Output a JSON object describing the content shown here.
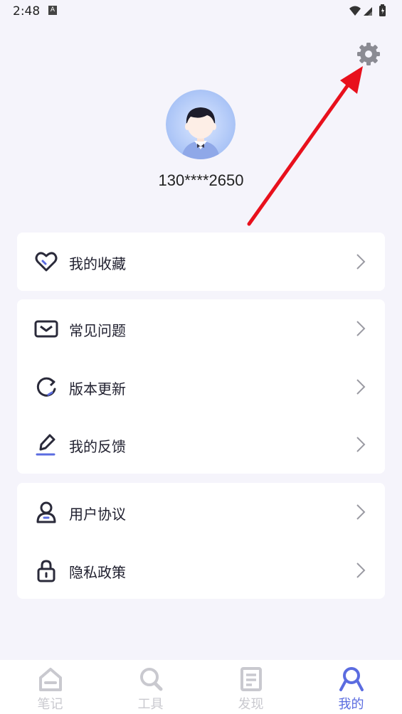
{
  "status_bar": {
    "time": "2:48",
    "notification_badge": "A"
  },
  "profile": {
    "phone": "130****2650"
  },
  "menu": {
    "favorites": "我的收藏",
    "faq": "常见问题",
    "version_update": "版本更新",
    "feedback": "我的反馈",
    "user_agreement": "用户协议",
    "privacy_policy": "隐私政策"
  },
  "tabs": [
    {
      "label": "笔记",
      "icon": "home-icon",
      "active": false
    },
    {
      "label": "工具",
      "icon": "search-icon",
      "active": false
    },
    {
      "label": "发现",
      "icon": "document-icon",
      "active": false
    },
    {
      "label": "我的",
      "icon": "profile-icon",
      "active": true
    }
  ],
  "colors": {
    "accent": "#5b6ce0",
    "annotation_arrow": "#e8101c",
    "background": "#f5f4fb",
    "icon_gray": "#c9c9cf"
  }
}
